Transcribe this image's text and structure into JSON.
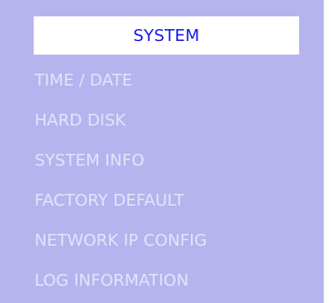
{
  "colors": {
    "panel_background": "#b6b4ee",
    "header_background": "#ffffff",
    "header_text": "#1616e8",
    "menu_text": "#e4e3fa"
  },
  "header": {
    "title": "SYSTEM"
  },
  "menu": {
    "items": [
      {
        "label": "TIME / DATE"
      },
      {
        "label": "HARD DISK"
      },
      {
        "label": "SYSTEM INFO"
      },
      {
        "label": "FACTORY DEFAULT"
      },
      {
        "label": "NETWORK IP CONFIG"
      },
      {
        "label": "LOG INFORMATION"
      }
    ]
  }
}
